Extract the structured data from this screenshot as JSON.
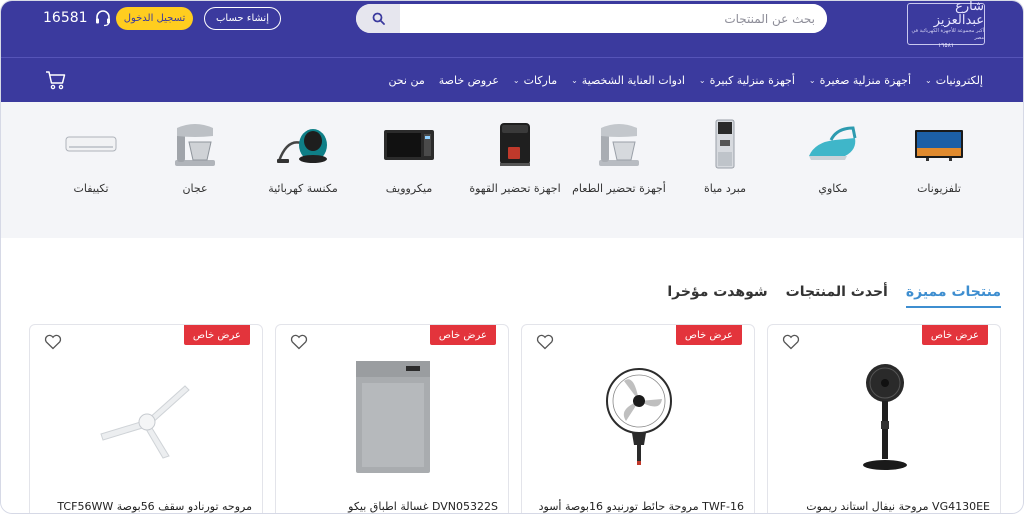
{
  "header": {
    "logo": {
      "line1": "شارع عبدالعزيز",
      "line2": "أكبر مجموعة للأجهزة الكهربائية في مصر",
      "line3": "١٦٥٨١"
    },
    "search": {
      "placeholder": "بحث عن المنتجات"
    },
    "register_label": "إنشاء حساب",
    "login_label": "تسجيل الدخول",
    "hotline": "16581"
  },
  "nav": {
    "items": [
      {
        "label": "إلكترونيات",
        "dropdown": true
      },
      {
        "label": "أجهزة منزلية صغيرة",
        "dropdown": true
      },
      {
        "label": "أجهزة منزلية كبيرة",
        "dropdown": true
      },
      {
        "label": "ادوات العناية الشخصية",
        "dropdown": true
      },
      {
        "label": "ماركات",
        "dropdown": true
      },
      {
        "label": "عروض خاصة",
        "dropdown": false
      },
      {
        "label": "من نحن",
        "dropdown": false
      }
    ]
  },
  "categories": [
    {
      "label": "تلفزيونات",
      "icon": "tv-icon"
    },
    {
      "label": "مكاوي",
      "icon": "iron-icon"
    },
    {
      "label": "مبرد مياة",
      "icon": "water-cooler-icon"
    },
    {
      "label": "أجهزة تحضير الطعام",
      "icon": "stand-mixer-icon"
    },
    {
      "label": "اجهزة تحضير القهوة",
      "icon": "coffee-machine-icon"
    },
    {
      "label": "ميكروويف",
      "icon": "microwave-icon"
    },
    {
      "label": "مكنسة كهربائية",
      "icon": "vacuum-icon"
    },
    {
      "label": "عجان",
      "icon": "dough-mixer-icon"
    },
    {
      "label": "تكييفات",
      "icon": "air-conditioner-icon"
    }
  ],
  "tabs": [
    {
      "label": "منتجات مميزة",
      "active": true
    },
    {
      "label": "أحدث المنتجات",
      "active": false
    },
    {
      "label": "شوهدت مؤخرا",
      "active": false
    }
  ],
  "products": [
    {
      "badge": "عرض خاص",
      "title": "VG4130EE مروحة نيفال استاند ريموت",
      "image": "stand-fan-icon"
    },
    {
      "badge": "عرض خاص",
      "title": "TWF-16 مروحة حائط تورنيدو 16بوصة أسود",
      "image": "wall-fan-icon"
    },
    {
      "badge": "عرض خاص",
      "title": "DVN05322S غسالة اطباق بيكو",
      "image": "dishwasher-icon"
    },
    {
      "badge": "عرض خاص",
      "title": "مروحه تورنادو سقف 56بوصة TCF56WW",
      "image": "ceiling-fan-icon"
    }
  ],
  "colors": {
    "primary": "#3b3a9e",
    "accent": "#ffcd1f",
    "badge": "#e3343c",
    "tab_active": "#3e8ed0"
  }
}
